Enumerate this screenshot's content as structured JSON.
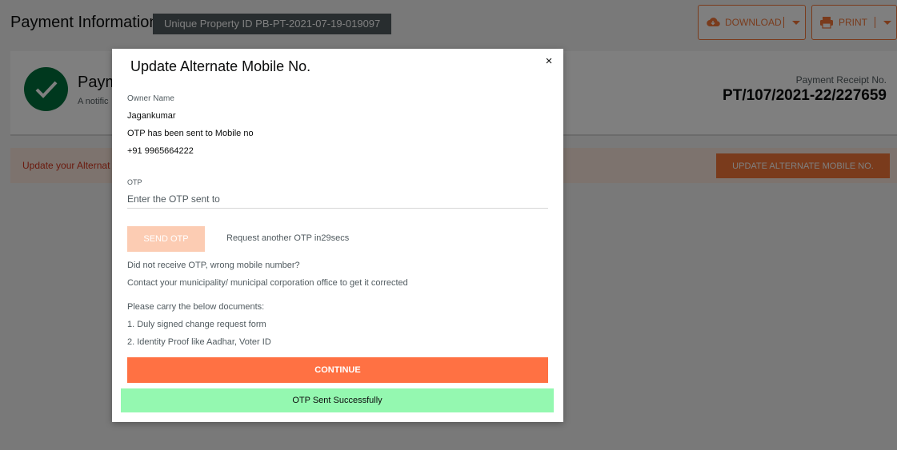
{
  "page": {
    "title": "Payment Information",
    "property_badge": "Unique Property ID PB-PT-2021-07-19-019097",
    "download_label": "DOWNLOAD",
    "print_label": "PRINT"
  },
  "card": {
    "heading": "Paym",
    "subtext": "A notific",
    "receipt_label": "Payment Receipt No.",
    "receipt_no": "PT/107/2021-22/227659"
  },
  "banner": {
    "text": "Update your Alternat",
    "button_label": "UPDATE ALTERNATE MOBILE NO."
  },
  "modal": {
    "title": "Update Alternate Mobile No.",
    "close_symbol": "×",
    "owner_label": "Owner Name",
    "owner_name": "Jagankumar",
    "otp_sent_text": "OTP has been sent to Mobile no",
    "mobile": "+91 9965664222",
    "otp_label": "OTP",
    "otp_value": "",
    "otp_placeholder": "Enter the OTP sent to",
    "send_otp_label": "SEND OTP",
    "resend_text": "Request another OTP in29secs",
    "not_received_text": "Did not receive OTP, wrong mobile number?",
    "contact_text": "Contact your municipality/ municipal corporation office to get it corrected",
    "documents_heading": "Please carry the below documents:",
    "documents": [
      "1. Duly signed change request form",
      "2. Identity Proof like Aadhar, Voter ID"
    ],
    "continue_label": "CONTINUE",
    "toast_text": "OTP Sent Successfully"
  },
  "colors": {
    "accent": "#f47738",
    "continue": "#ff7143",
    "success_toast": "#94f8b0",
    "check_green": "#00703c"
  },
  "icons": {
    "download": "cloud-download-icon",
    "print": "printer-icon",
    "check": "check-icon",
    "close": "close-icon",
    "caret": "chevron-down-icon"
  }
}
